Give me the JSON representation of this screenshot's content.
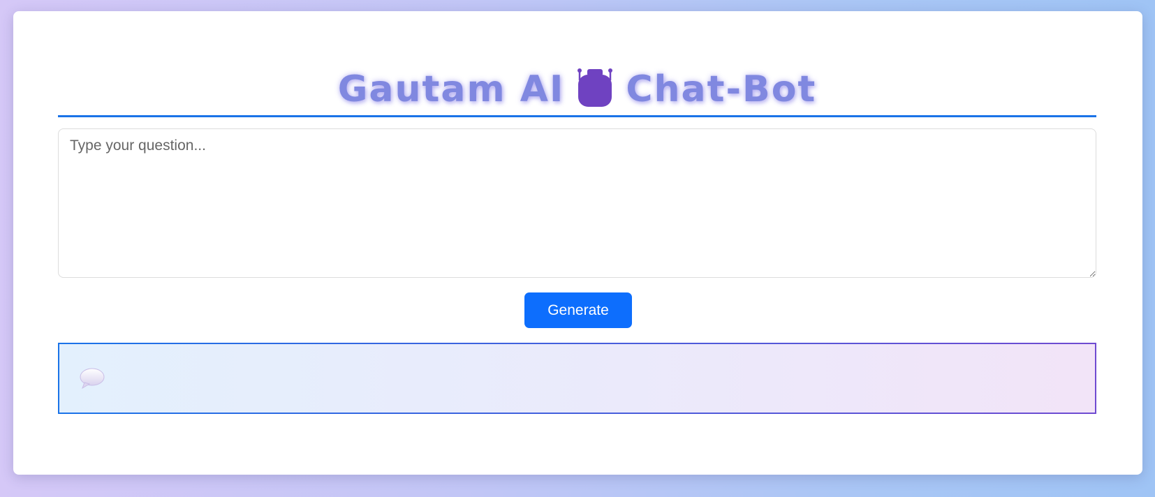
{
  "header": {
    "title_part1": "Gautam AI",
    "title_part2": "Chat-Bot",
    "icon": "robot-icon"
  },
  "question": {
    "placeholder": "Type your question...",
    "value": ""
  },
  "actions": {
    "generate_label": "Generate"
  },
  "answer": {
    "icon": "speech-bubble-icon",
    "text": ""
  },
  "colors": {
    "accent": "#1a73e8",
    "button": "#0d6efd",
    "title": "#8088e0",
    "robot": "#6f42c1"
  }
}
